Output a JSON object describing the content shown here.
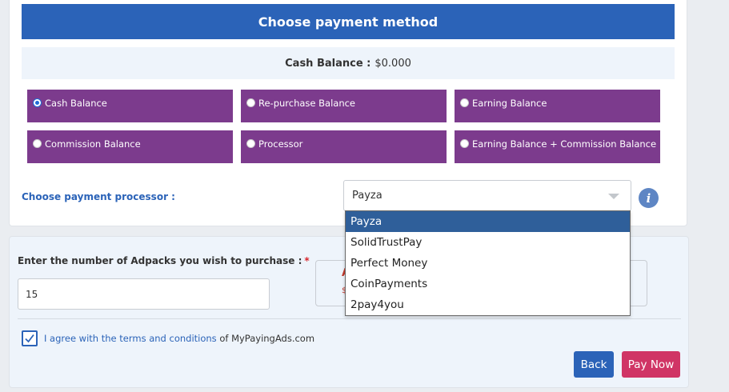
{
  "header": {
    "title": "Choose payment method"
  },
  "balance": {
    "label": "Cash Balance :",
    "value": "$0.000"
  },
  "payment_options": [
    {
      "label": "Cash Balance",
      "checked": true
    },
    {
      "label": "Re-purchase Balance",
      "checked": false
    },
    {
      "label": "Earning Balance",
      "checked": false
    },
    {
      "label": "Commission Balance",
      "checked": false
    },
    {
      "label": "Processor",
      "checked": false
    },
    {
      "label": "Earning Balance + Commission Balance",
      "checked": false
    }
  ],
  "processor": {
    "label": "Choose payment processor :",
    "selected": "Payza",
    "options": [
      "Payza",
      "SolidTrustPay",
      "Perfect Money",
      "CoinPayments",
      "2pay4you"
    ],
    "info_icon": "info-icon"
  },
  "adpacks": {
    "label": "Enter the number of Adpacks you wish to purchase :",
    "required_mark": "*",
    "value": "15",
    "partial_red_text": "A",
    "partial_red_text2": "$"
  },
  "terms": {
    "checked": true,
    "link_text": "I agree with the terms and conditions",
    "connector": "of",
    "site": "MyPayingAds.com"
  },
  "buttons": {
    "back": "Back",
    "pay": "Pay Now"
  },
  "colors": {
    "primary": "#2b63b8",
    "option_bg": "#7c3b8d",
    "pay_button": "#d03565",
    "dropdown_selected": "#2f5f9a"
  }
}
